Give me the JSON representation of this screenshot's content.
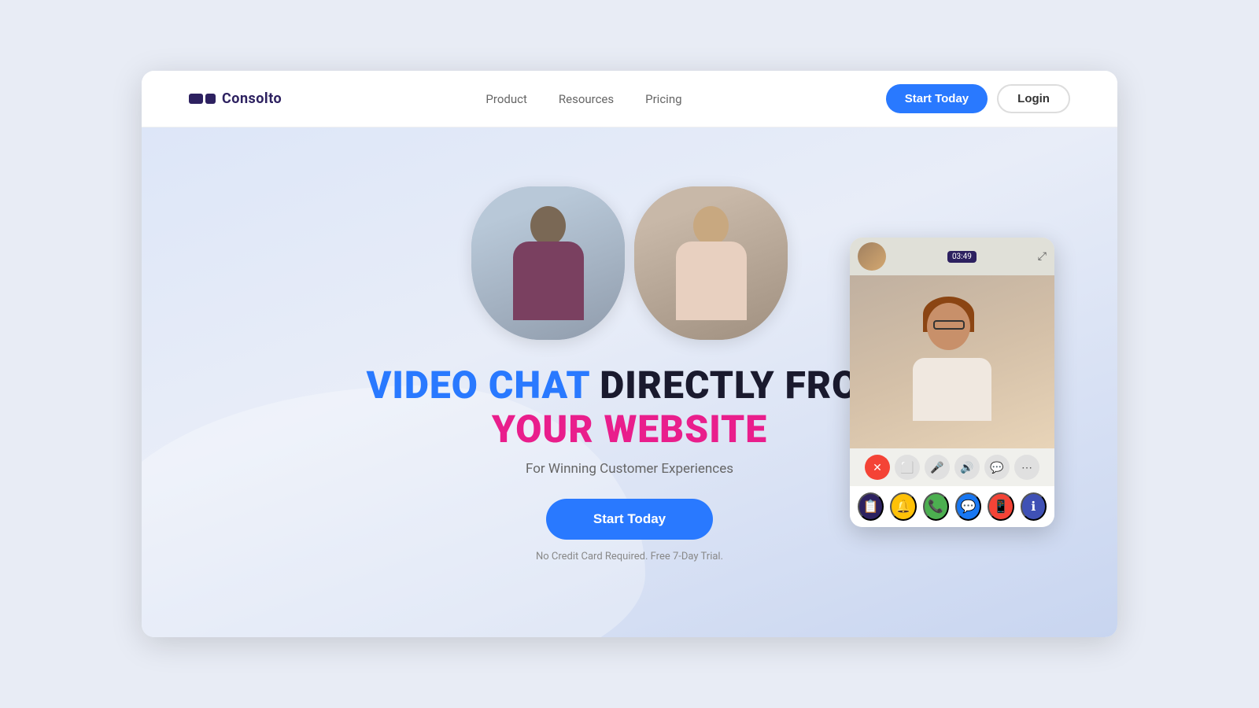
{
  "brand": {
    "name": "Consolto",
    "logo_alt": "Consolto logo"
  },
  "navbar": {
    "links": [
      {
        "label": "Product",
        "id": "nav-product"
      },
      {
        "label": "Resources",
        "id": "nav-resources"
      },
      {
        "label": "Pricing",
        "id": "nav-pricing"
      }
    ],
    "cta_label": "Start Today",
    "login_label": "Login"
  },
  "hero": {
    "title_part1": "VIDEO CHAT",
    "title_part2": "DIRECTLY FROM",
    "title_line2": "YOUR WEBSITE",
    "subtitle": "For Winning Customer Experiences",
    "cta_label": "Start Today",
    "note": "No Credit Card Required. Free 7-Day Trial."
  },
  "video_widget": {
    "timer": "03:49",
    "expand_icon": "⤢",
    "controls": [
      {
        "id": "end-call",
        "icon": "✕",
        "type": "red"
      },
      {
        "id": "screen-share",
        "icon": "⬜",
        "type": "gray"
      },
      {
        "id": "mute-mic",
        "icon": "🎤",
        "type": "gray"
      },
      {
        "id": "volume",
        "icon": "🔊",
        "type": "gray"
      },
      {
        "id": "chat",
        "icon": "💬",
        "type": "gray"
      },
      {
        "id": "more",
        "icon": "⋯",
        "type": "gray"
      }
    ],
    "apps": [
      {
        "id": "app-copy",
        "icon": "📋",
        "type": "dark"
      },
      {
        "id": "app-bell",
        "icon": "🔔",
        "type": "yellow"
      },
      {
        "id": "app-whatsapp",
        "icon": "📞",
        "type": "green"
      },
      {
        "id": "app-messenger",
        "icon": "💬",
        "type": "blue"
      },
      {
        "id": "app-phone-red",
        "icon": "📱",
        "type": "red"
      },
      {
        "id": "app-info",
        "icon": "ℹ",
        "type": "indigo"
      }
    ]
  }
}
